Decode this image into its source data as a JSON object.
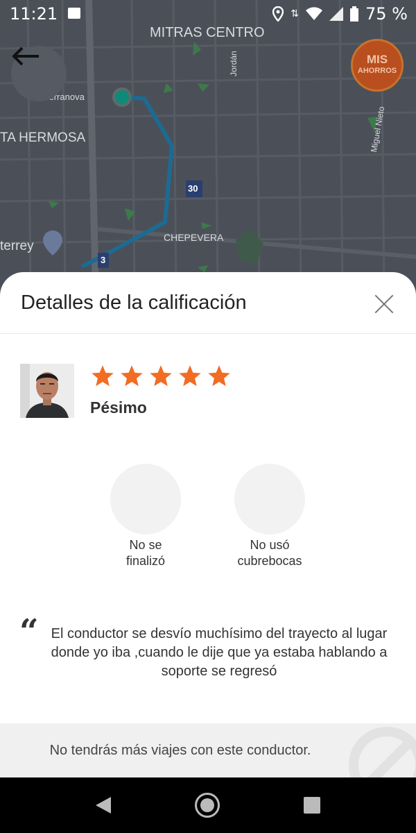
{
  "status_bar": {
    "time": "11:21",
    "battery": "75 %",
    "icons": [
      "image-icon",
      "location-icon",
      "data-arrows-icon",
      "wifi-icon",
      "signal-icon",
      "battery-icon"
    ]
  },
  "map": {
    "labels": {
      "mitras_centro": "MITRAS CENTRO",
      "terranova": "Terranova",
      "ta_hermosa": "TA HERMOSA",
      "jordan": "Jordán",
      "miguel_nieto": "Miguel Nieto",
      "route_30": "30",
      "chepevera": "CHEPEVERA",
      "terrey": "terrey",
      "route_3": "3"
    },
    "savings_button": {
      "line1": "MIS",
      "line2": "AHORROS"
    },
    "route_color": "#1c6b93",
    "origin_color": "#0f8a78"
  },
  "sheet": {
    "title": "Detalles de la calificación",
    "rating_text": "Pésimo",
    "stars_shown": 5,
    "star_color": "#f26c22",
    "tags": [
      {
        "label": "No se finalizó"
      },
      {
        "label": "No usó cubrebocas"
      }
    ],
    "quote_mark": "“",
    "comment": "El conductor se desvío muchísimo del trayecto al lugar donde yo iba ,cuando le dije que ya estaba hablando a soporte se regresó",
    "footer_text": "No tendrás más viajes con este conductor."
  }
}
